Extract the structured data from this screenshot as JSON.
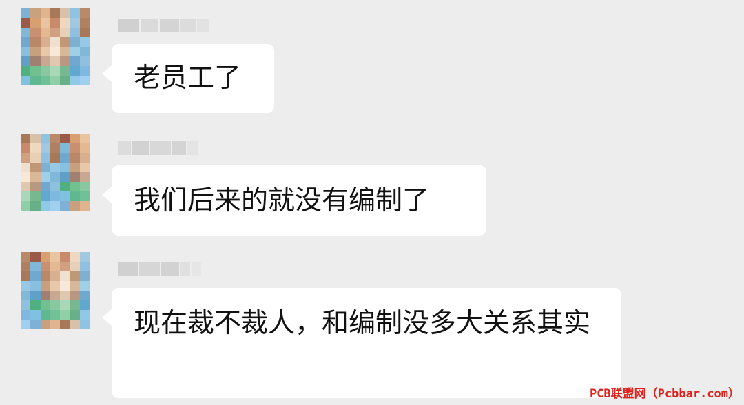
{
  "messages": [
    {
      "text": "老员工了"
    },
    {
      "text": "我们后来的就没有编制了"
    },
    {
      "text": "现在裁不裁人，和编制没多大关系其实"
    }
  ],
  "watermark": "PCB联盟网（Pcbbar.com）",
  "colors": {
    "background": "#ededed",
    "bubble": "#ffffff",
    "text": "#111111",
    "watermark": "#e0201a"
  }
}
